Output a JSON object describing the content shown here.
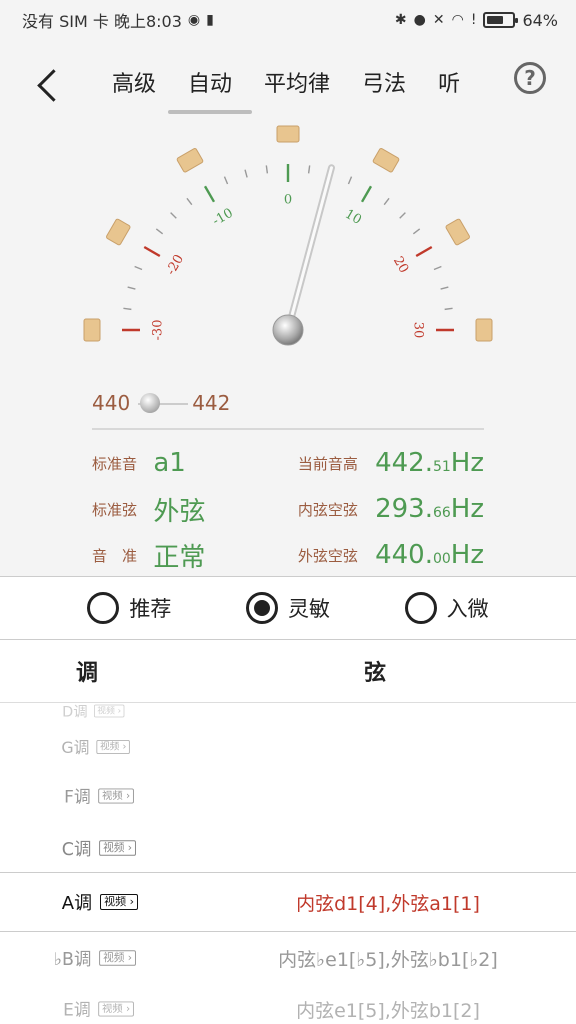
{
  "status": {
    "carrier": "没有 SIM 卡 晚上8:03",
    "battery": "64%",
    "battery_level": 0.64
  },
  "nav": {
    "tabs": [
      "高级",
      "自动",
      "平均律",
      "弓法",
      "听"
    ],
    "active_tab": "自动",
    "help_label": "?"
  },
  "tuner": {
    "scale_labels": [
      "-30",
      "-20",
      "-10",
      "0",
      "10",
      "20",
      "30"
    ],
    "needle_value": 5
  },
  "reference": {
    "min": "440",
    "max": "442",
    "value": 440
  },
  "info": {
    "std_pitch_label": "标准音",
    "std_pitch_value": "a1",
    "current_label": "当前音高",
    "current_int": "442.",
    "current_dec": "51",
    "current_unit": "Hz",
    "std_string_label": "标准弦",
    "std_string_value": "外弦",
    "inner_label": "内弦空弦",
    "inner_int": "293.",
    "inner_dec": "66",
    "inner_unit": "Hz",
    "tone_label": "音　准",
    "tone_value": "正常",
    "outer_label": "外弦空弦",
    "outer_int": "440.",
    "outer_dec": "00",
    "outer_unit": "Hz"
  },
  "modes": {
    "options": [
      "推荐",
      "灵敏",
      "入微"
    ],
    "selected": "灵敏"
  },
  "table": {
    "header_key": "调",
    "header_string": "弦",
    "video_label": "视频",
    "rows": [
      {
        "key": "D调",
        "strings": ""
      },
      {
        "key": "G调",
        "strings": ""
      },
      {
        "key": "F调",
        "strings": ""
      },
      {
        "key": "C调",
        "strings": ""
      },
      {
        "key": "A调",
        "strings": "内弦d1[4],外弦a1[1]"
      },
      {
        "key": "♭B调",
        "strings": "内弦♭e1[♭5],外弦♭b1[♭2]"
      },
      {
        "key": "E调",
        "strings": "内弦e1[5],外弦b1[2]"
      }
    ]
  },
  "colors": {
    "accent_green": "#4e9a52",
    "accent_red": "#c0392b",
    "label_brown": "#9b5c40",
    "marker_tan": "#e8c58f"
  }
}
